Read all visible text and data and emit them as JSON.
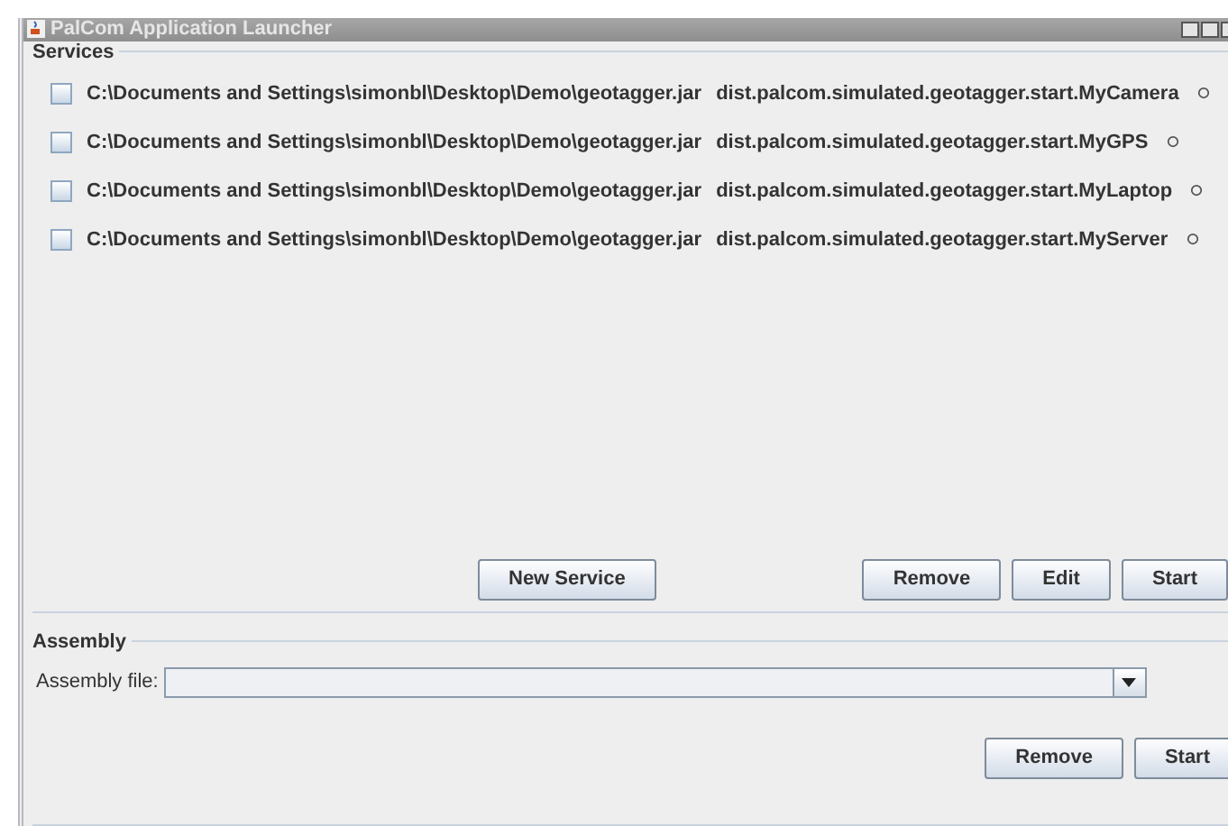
{
  "window": {
    "title": "PalCom Application Launcher"
  },
  "services": {
    "title": "Services",
    "items": [
      {
        "checked": false,
        "jar": "C:\\Documents and Settings\\simonbl\\Desktop\\Demo\\geotagger.jar",
        "class_name": "dist.palcom.simulated.geotagger.start.MyCamera"
      },
      {
        "checked": false,
        "jar": "C:\\Documents and Settings\\simonbl\\Desktop\\Demo\\geotagger.jar",
        "class_name": "dist.palcom.simulated.geotagger.start.MyGPS"
      },
      {
        "checked": false,
        "jar": "C:\\Documents and Settings\\simonbl\\Desktop\\Demo\\geotagger.jar",
        "class_name": "dist.palcom.simulated.geotagger.start.MyLaptop"
      },
      {
        "checked": false,
        "jar": "C:\\Documents and Settings\\simonbl\\Desktop\\Demo\\geotagger.jar",
        "class_name": "dist.palcom.simulated.geotagger.start.MyServer"
      }
    ],
    "left_buttons": [
      "New Service"
    ],
    "right_buttons": [
      "Remove",
      "Edit",
      "Start"
    ]
  },
  "assembly": {
    "title": "Assembly",
    "file_label": "Assembly file:",
    "buttons": [
      "Remove",
      "Start"
    ]
  }
}
